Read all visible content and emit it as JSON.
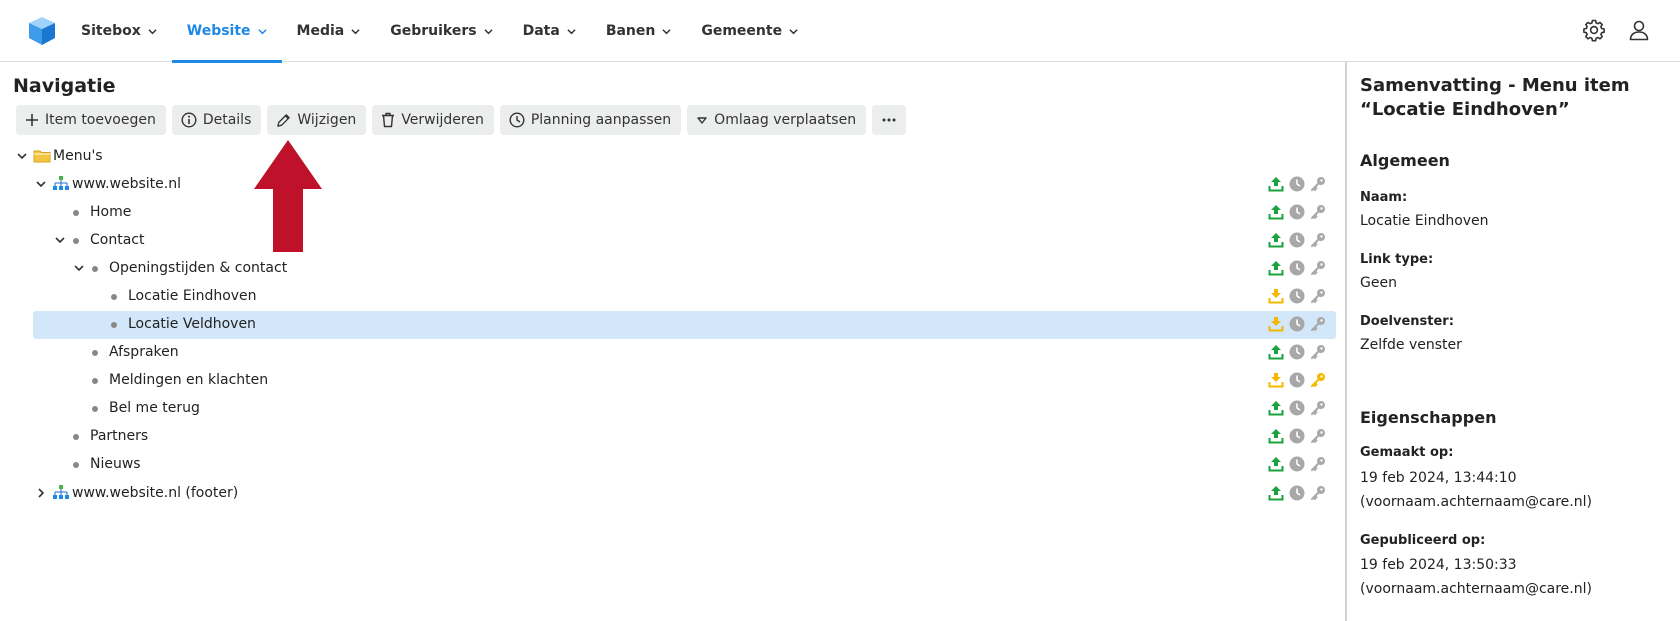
{
  "nav": {
    "items": [
      {
        "label": "Sitebox",
        "active": false
      },
      {
        "label": "Website",
        "active": true
      },
      {
        "label": "Media",
        "active": false
      },
      {
        "label": "Gebruikers",
        "active": false
      },
      {
        "label": "Data",
        "active": false
      },
      {
        "label": "Banen",
        "active": false
      },
      {
        "label": "Gemeente",
        "active": false
      }
    ],
    "icons": [
      "gear-icon",
      "user-icon"
    ]
  },
  "page": {
    "title": "Navigatie"
  },
  "toolbar": {
    "add": "Item toevoegen",
    "details": "Details",
    "edit": "Wijzigen",
    "delete": "Verwijderen",
    "schedule": "Planning aanpassen",
    "move_down": "Omlaag verplaatsen"
  },
  "tree": [
    {
      "label": "Menu's",
      "type": "folder",
      "expanded": true,
      "status": null
    },
    {
      "label": "www.website.nl",
      "type": "site",
      "expanded": true,
      "status": {
        "publish": "published",
        "key": "grey"
      }
    },
    {
      "label": "Home",
      "type": "item",
      "status": {
        "publish": "published",
        "key": "grey"
      }
    },
    {
      "label": "Contact",
      "type": "item",
      "expanded": true,
      "status": {
        "publish": "published",
        "key": "grey"
      }
    },
    {
      "label": "Openingstijden & contact",
      "type": "item",
      "expanded": true,
      "status": {
        "publish": "published",
        "key": "grey"
      }
    },
    {
      "label": "Locatie Eindhoven",
      "type": "item",
      "status": {
        "publish": "pending",
        "key": "grey"
      }
    },
    {
      "label": "Locatie Veldhoven",
      "type": "item",
      "selected": true,
      "status": {
        "publish": "pending",
        "key": "grey"
      }
    },
    {
      "label": "Afspraken",
      "type": "item",
      "status": {
        "publish": "published",
        "key": "grey"
      }
    },
    {
      "label": "Meldingen en klachten",
      "type": "item",
      "status": {
        "publish": "pending",
        "key": "yellow"
      }
    },
    {
      "label": "Bel me terug",
      "type": "item",
      "status": {
        "publish": "published",
        "key": "grey"
      }
    },
    {
      "label": "Partners",
      "type": "item",
      "status": {
        "publish": "published",
        "key": "grey"
      }
    },
    {
      "label": "Nieuws",
      "type": "item",
      "status": {
        "publish": "published",
        "key": "grey"
      }
    },
    {
      "label": "www.website.nl (footer)",
      "type": "site",
      "expanded": false,
      "status": {
        "publish": "published",
        "key": "grey"
      }
    }
  ],
  "summary": {
    "title": "Samenvatting - Menu item “Locatie Eindhoven”",
    "general_heading": "Algemeen",
    "name_label": "Naam:",
    "name_value": "Locatie Eindhoven",
    "link_type_label": "Link type:",
    "link_type_value": "Geen",
    "target_label": "Doelvenster:",
    "target_value": "Zelfde venster",
    "props_heading": "Eigenschappen",
    "created_label": "Gemaakt op:",
    "created_date": "19 feb 2024, 13:44:10",
    "created_by": "(voornaam.achternaam@care.nl)",
    "published_label": "Gepubliceerd op:",
    "published_date": "19 feb 2024, 13:50:33",
    "published_by": "(voornaam.achternaam@care.nl)"
  },
  "colors": {
    "accent": "#1e88e5",
    "selected_row": "#d3e7fa",
    "published": "#1aa33c",
    "pending": "#f5b800",
    "annotation_arrow": "#c0112a"
  }
}
